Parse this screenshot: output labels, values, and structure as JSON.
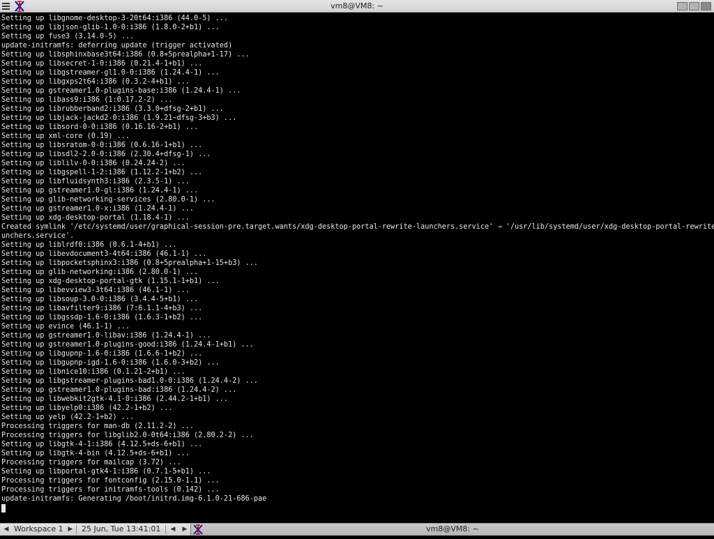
{
  "window": {
    "title": "vm8@VM8: ~",
    "app_icon": "xterm-x-icon"
  },
  "terminal": {
    "lines": [
      "Setting up libgnome-desktop-3-20t64:i386 (44.0-5) ...",
      "Setting up libjson-glib-1.0-0:i386 (1.8.0-2+b1) ...",
      "Setting up fuse3 (3.14.0-5) ...",
      "update-initramfs: deferring update (trigger activated)",
      "Setting up libsphinxbase3t64:i386 (0.8+5prealpha+1-17) ...",
      "Setting up libsecret-1-0:i386 (0.21.4-1+b1) ...",
      "Setting up libgstreamer-gl1.0-0:i386 (1.24.4-1) ...",
      "Setting up libgxps2t64:i386 (0.3.2-4+b1) ...",
      "Setting up gstreamer1.0-plugins-base:i386 (1.24.4-1) ...",
      "Setting up libass9:i386 (1:0.17.2-2) ...",
      "Setting up librubberband2:i386 (3.3.0+dfsg-2+b1) ...",
      "Setting up libjack-jackd2-0:i386 (1.9.21~dfsg-3+b3) ...",
      "Setting up libsord-0-0:i386 (0.16.16-2+b1) ...",
      "Setting up xml-core (0.19) ...",
      "Setting up libsratom-0-0:i386 (0.6.16-1+b1) ...",
      "Setting up libsdl2-2.0-0:i386 (2.30.4+dfsg-1) ...",
      "Setting up liblilv-0-0:i386 (0.24.24-2) ...",
      "Setting up libgspell-1-2:i386 (1.12.2-1+b2) ...",
      "Setting up libfluidsynth3:i386 (2.3.5-1) ...",
      "Setting up gstreamer1.0-gl:i386 (1.24.4-1) ...",
      "Setting up glib-networking-services (2.80.0-1) ...",
      "Setting up gstreamer1.0-x:i386 (1.24.4-1) ...",
      "Setting up xdg-desktop-portal (1.18.4-1) ...",
      "Created symlink '/etc/systemd/user/graphical-session-pre.target.wants/xdg-desktop-portal-rewrite-launchers.service' → '/usr/lib/systemd/user/xdg-desktop-portal-rewrite-la",
      "unchers.service'.",
      "Setting up liblrdf0:i386 (0.6.1-4+b1) ...",
      "Setting up libevdocument3-4t64:i386 (46.1-1) ...",
      "Setting up libpocketsphinx3:i386 (0.8+5prealpha+1-15+b3) ...",
      "Setting up glib-networking:i386 (2.80.0-1) ...",
      "Setting up xdg-desktop-portal-gtk (1.15.1-1+b1) ...",
      "Setting up libevview3-3t64:i386 (46.1-1) ...",
      "Setting up libsoup-3.0-0:i386 (3.4.4-5+b1) ...",
      "Setting up libavfilter9:i386 (7:6.1.1-4+b3) ...",
      "Setting up libgssdp-1.6-0:i386 (1.6.3-1+b2) ...",
      "Setting up evince (46.1-1) ...",
      "Setting up gstreamer1.0-libav:i386 (1.24.4-1) ...",
      "Setting up gstreamer1.0-plugins-good:i386 (1.24.4-1+b1) ...",
      "Setting up libgupnp-1.6-0:i386 (1.6.6-1+b2) ...",
      "Setting up libgupnp-igd-1.6-0:i386 (1.6.0-3+b2) ...",
      "Setting up libnice10:i386 (0.1.21-2+b1) ...",
      "Setting up libgstreamer-plugins-bad1.0-0:i386 (1.24.4-2) ...",
      "Setting up gstreamer1.0-plugins-bad:i386 (1.24.4-2) ...",
      "Setting up libwebkit2gtk-4.1-0:i386 (2.44.2-1+b1) ...",
      "Setting up libyelp0:i386 (42.2-1+b2) ...",
      "Setting up yelp (42.2-1+b2) ...",
      "Processing triggers for man-db (2.11.2-2) ...",
      "Processing triggers for libglib2.0-0t64:i386 (2.80.2-2) ...",
      "Setting up libgtk-4-1:i386 (4.12.5+ds-6+b1) ...",
      "Setting up libgtk-4-bin (4.12.5+ds-6+b1) ...",
      "Processing triggers for mailcap (3.72) ...",
      "Setting up libportal-gtk4-1:i386 (0.7.1-5+b1) ...",
      "Processing triggers for fontconfig (2.15.0-1.1) ...",
      "Processing triggers for initramfs-tools (0.142) ...",
      "update-initramfs: Generating /boot/initrd.img-6.1.0-21-686-pae"
    ],
    "colors": {
      "background": "#000000",
      "foreground": "#e8e8e8"
    }
  },
  "panel": {
    "workspace_label": "Workspace 1",
    "clock": "25 Jun, Tue 13:41:01",
    "task_label": "vm8@VM8: ~",
    "icons": {
      "ws_prev": "arrow-left-icon",
      "ws_next": "arrow-right-icon",
      "task_prev": "arrow-left-icon",
      "task_next": "arrow-right-icon",
      "task_icon": "xterm-x-icon"
    }
  }
}
